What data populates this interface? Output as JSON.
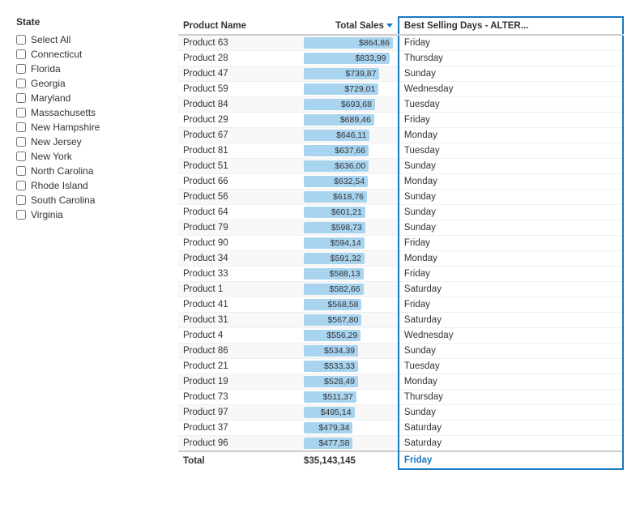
{
  "sidebar": {
    "title": "State",
    "items": [
      {
        "label": "Select All",
        "checked": false
      },
      {
        "label": "Connecticut",
        "checked": false
      },
      {
        "label": "Florida",
        "checked": false
      },
      {
        "label": "Georgia",
        "checked": false
      },
      {
        "label": "Maryland",
        "checked": false
      },
      {
        "label": "Massachusetts",
        "checked": false
      },
      {
        "label": "New Hampshire",
        "checked": false
      },
      {
        "label": "New Jersey",
        "checked": false
      },
      {
        "label": "New York",
        "checked": false
      },
      {
        "label": "North Carolina",
        "checked": false
      },
      {
        "label": "Rhode Island",
        "checked": false
      },
      {
        "label": "South Carolina",
        "checked": false
      },
      {
        "label": "Virginia",
        "checked": false
      }
    ]
  },
  "table": {
    "columns": [
      {
        "label": "Product Name",
        "key": "product"
      },
      {
        "label": "Total Sales",
        "key": "sales"
      },
      {
        "label": "Best Selling Days - ALTER...",
        "key": "day"
      }
    ],
    "rows": [
      {
        "product": "Product 63",
        "sales": "$864,86",
        "day": "Friday",
        "bar": 100
      },
      {
        "product": "Product 28",
        "sales": "$833,99",
        "day": "Thursday",
        "bar": 96
      },
      {
        "product": "Product 47",
        "sales": "$739,87",
        "day": "Sunday",
        "bar": 85
      },
      {
        "product": "Product 59",
        "sales": "$729,01",
        "day": "Wednesday",
        "bar": 84
      },
      {
        "product": "Product 84",
        "sales": "$693,68",
        "day": "Tuesday",
        "bar": 80
      },
      {
        "product": "Product 29",
        "sales": "$689,46",
        "day": "Friday",
        "bar": 79
      },
      {
        "product": "Product 67",
        "sales": "$646,11",
        "day": "Monday",
        "bar": 74
      },
      {
        "product": "Product 81",
        "sales": "$637,66",
        "day": "Tuesday",
        "bar": 73
      },
      {
        "product": "Product 51",
        "sales": "$636,00",
        "day": "Sunday",
        "bar": 73
      },
      {
        "product": "Product 66",
        "sales": "$632,54",
        "day": "Monday",
        "bar": 72
      },
      {
        "product": "Product 56",
        "sales": "$618,76",
        "day": "Sunday",
        "bar": 71
      },
      {
        "product": "Product 64",
        "sales": "$601,21",
        "day": "Sunday",
        "bar": 69
      },
      {
        "product": "Product 79",
        "sales": "$598,73",
        "day": "Sunday",
        "bar": 69
      },
      {
        "product": "Product 90",
        "sales": "$594,14",
        "day": "Friday",
        "bar": 68
      },
      {
        "product": "Product 34",
        "sales": "$591,32",
        "day": "Monday",
        "bar": 68
      },
      {
        "product": "Product 33",
        "sales": "$588,13",
        "day": "Friday",
        "bar": 67
      },
      {
        "product": "Product 1",
        "sales": "$582,66",
        "day": "Saturday",
        "bar": 67
      },
      {
        "product": "Product 41",
        "sales": "$568,58",
        "day": "Friday",
        "bar": 65
      },
      {
        "product": "Product 31",
        "sales": "$567,80",
        "day": "Saturday",
        "bar": 65
      },
      {
        "product": "Product 4",
        "sales": "$556,29",
        "day": "Wednesday",
        "bar": 64
      },
      {
        "product": "Product 86",
        "sales": "$534,39",
        "day": "Sunday",
        "bar": 61
      },
      {
        "product": "Product 21",
        "sales": "$533,33",
        "day": "Tuesday",
        "bar": 61
      },
      {
        "product": "Product 19",
        "sales": "$528,49",
        "day": "Monday",
        "bar": 61
      },
      {
        "product": "Product 73",
        "sales": "$511,37",
        "day": "Thursday",
        "bar": 59
      },
      {
        "product": "Product 97",
        "sales": "$495,14",
        "day": "Sunday",
        "bar": 57
      },
      {
        "product": "Product 37",
        "sales": "$479,34",
        "day": "Saturday",
        "bar": 55
      },
      {
        "product": "Product 96",
        "sales": "$477,58",
        "day": "Saturday",
        "bar": 55
      }
    ],
    "footer": {
      "label": "Total",
      "sales": "$35,143,145",
      "day": "Friday"
    }
  }
}
